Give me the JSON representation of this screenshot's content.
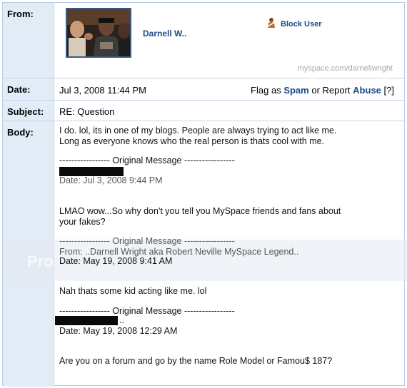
{
  "from": {
    "label": "From:",
    "sender_name": "Darnell W..",
    "block_label": "Block User",
    "profile_url": "myspace.com/darnellwright"
  },
  "date": {
    "label": "Date:",
    "value": "Jul 3, 2008 11:44 PM",
    "flag_as": "Flag as",
    "spam": "Spam",
    "or_report": "or Report",
    "abuse": "Abuse",
    "help": "[?]"
  },
  "subject": {
    "label": "Subject:",
    "value": "RE: Question"
  },
  "body": {
    "label": "Body:",
    "lines": [
      "I do. lol, its in one of my blogs. People are always trying to act like me.",
      "Long as everyone knows who the real person is thats cool with me.",
      "----------------- Original Message -----------------",
      "Date: Jul 3, 2008 9:44 PM",
      "LMAO wow...So why don't you tell you MySpace friends and fans about",
      "your fakes?",
      "----------------- Original Message -----------------",
      "From: ..Darnell Wright aka Robert Neville MySpace Legend..",
      "Date: May 19, 2008 9:41 AM",
      "Nah thats some kid acting like me. lol",
      "----------------- Original Message -----------------",
      "..",
      "Date: May 19, 2008 12:29 AM",
      "Are you on a forum and go by the name Role Model or Famou$ 187?"
    ],
    "watermark": "Pro"
  }
}
